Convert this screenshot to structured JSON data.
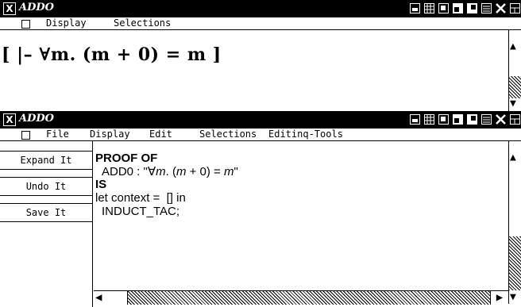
{
  "window1": {
    "title": "ADDO",
    "menu": [
      "Display",
      "Selections"
    ],
    "goal_text": "[ |– ∀m. (m + 0) = m ]"
  },
  "window2": {
    "title": "ADDO",
    "menu": [
      "File",
      "Display",
      "Edit",
      "Selections",
      "Editinq-Tools"
    ],
    "buttons": [
      "Expand It",
      "Undo It",
      "Save It"
    ],
    "editor": {
      "line1": "PROOF OF",
      "line2_prefix": "ADD0 : \"∀",
      "line2_italic_m": "m",
      "line2_mid": ". (",
      "line2_m2": "m",
      "line2_plus": " + 0) = ",
      "line2_m3": "m",
      "line2_end": "\"",
      "line3": "IS",
      "line4": "let context =  [] in",
      "line5": "INDUCT_TAC;"
    }
  },
  "icons": [
    "close-box-icon",
    "iconify-icon",
    "grid-icon",
    "move-icon",
    "resize-icon",
    "lower-icon",
    "raise-icon",
    "destroy-icon",
    "menu-icon"
  ]
}
